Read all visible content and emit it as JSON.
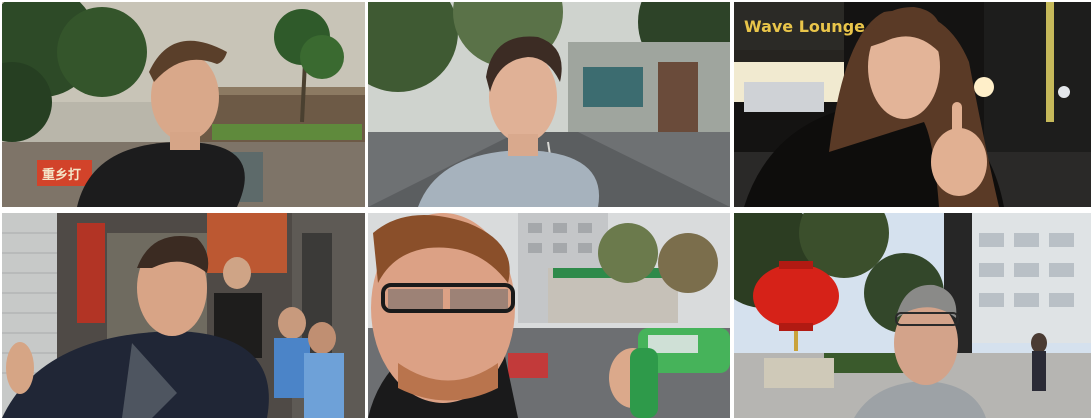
{
  "tiles": [
    {
      "id": "tile-1",
      "scene": "tropical-plaza",
      "sign_text": "重乡打"
    },
    {
      "id": "tile-2",
      "scene": "tree-lined-street"
    },
    {
      "id": "tile-3",
      "scene": "night-street",
      "sign_text": "Wave Lounge"
    },
    {
      "id": "tile-4",
      "scene": "market-alley"
    },
    {
      "id": "tile-5",
      "scene": "city-street-with-bus"
    },
    {
      "id": "tile-6",
      "scene": "plaza-with-red-lantern"
    }
  ],
  "colors": {
    "sky_dusk": "#c7c2b4",
    "foliage": "#2f4a25",
    "lantern_red": "#d62218",
    "night": "#151412",
    "bus_green": "#46b35a"
  }
}
